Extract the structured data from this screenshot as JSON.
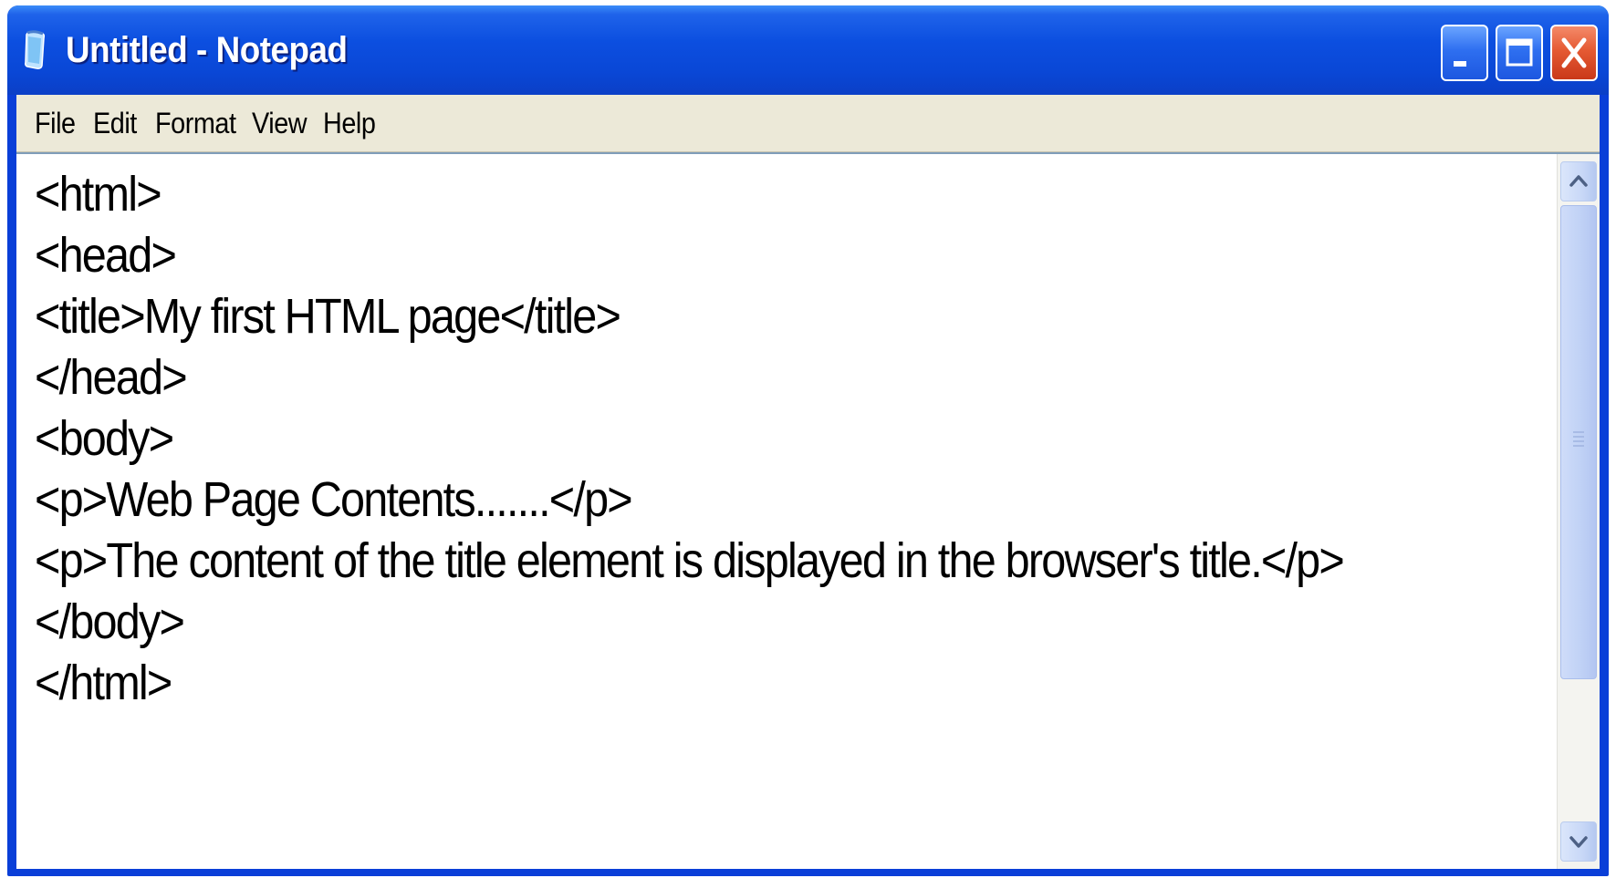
{
  "window": {
    "title": "Untitled - Notepad",
    "titlebar_color": "#0a47d6",
    "close_button_color": "#e55a33"
  },
  "menu": {
    "items": [
      "File",
      "Edit",
      "Format",
      "View",
      "Help"
    ]
  },
  "editor": {
    "lines": [
      "<html>",
      "<head>",
      "<title>My first HTML page</title>",
      "</head>",
      "<body>",
      "<p>Web Page Contents.......</p>",
      "<p>The content of the title element is displayed in the browser's title.</p>",
      "</body>",
      "</html>"
    ]
  },
  "icons": {
    "app": "notepad-icon",
    "minimize": "minimize-icon",
    "maximize": "maximize-icon",
    "close": "close-icon",
    "scroll_up": "chevron-up-icon",
    "scroll_down": "chevron-down-icon"
  }
}
